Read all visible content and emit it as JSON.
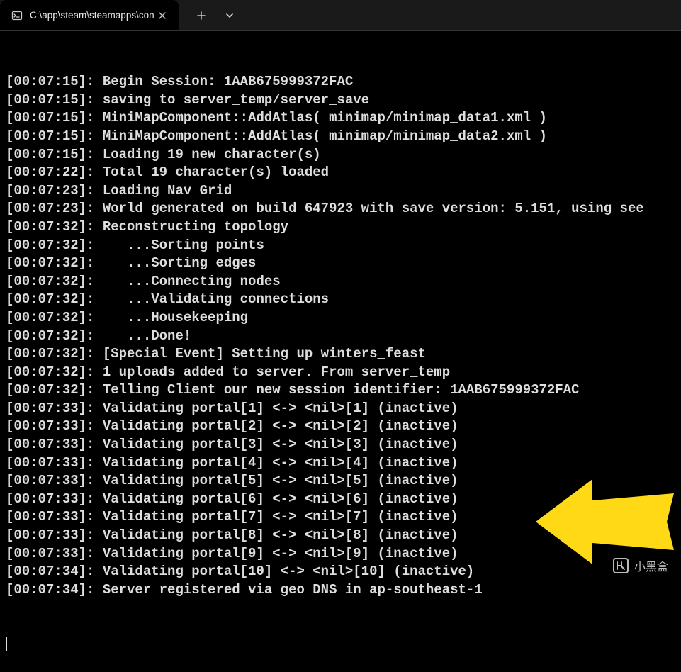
{
  "tab": {
    "title": "C:\\app\\steam\\steamapps\\con"
  },
  "log_lines": [
    "[00:07:15]: Begin Session: 1AAB675999372FAC",
    "[00:07:15]: saving to server_temp/server_save",
    "[00:07:15]: MiniMapComponent::AddAtlas( minimap/minimap_data1.xml )",
    "[00:07:15]: MiniMapComponent::AddAtlas( minimap/minimap_data2.xml )",
    "[00:07:15]: Loading 19 new character(s)",
    "[00:07:22]: Total 19 character(s) loaded",
    "[00:07:23]: Loading Nav Grid",
    "[00:07:23]: World generated on build 647923 with save version: 5.151, using see",
    "[00:07:32]: Reconstructing topology",
    "[00:07:32]:    ...Sorting points",
    "[00:07:32]:    ...Sorting edges",
    "[00:07:32]:    ...Connecting nodes",
    "[00:07:32]:    ...Validating connections",
    "[00:07:32]:    ...Housekeeping",
    "[00:07:32]:    ...Done!",
    "[00:07:32]: [Special Event] Setting up winters_feast",
    "[00:07:32]: 1 uploads added to server. From server_temp",
    "[00:07:32]: Telling Client our new session identifier: 1AAB675999372FAC",
    "[00:07:33]: Validating portal[1] <-> <nil>[1] (inactive)",
    "[00:07:33]: Validating portal[2] <-> <nil>[2] (inactive)",
    "[00:07:33]: Validating portal[3] <-> <nil>[3] (inactive)",
    "[00:07:33]: Validating portal[4] <-> <nil>[4] (inactive)",
    "[00:07:33]: Validating portal[5] <-> <nil>[5] (inactive)",
    "[00:07:33]: Validating portal[6] <-> <nil>[6] (inactive)",
    "[00:07:33]: Validating portal[7] <-> <nil>[7] (inactive)",
    "[00:07:33]: Validating portal[8] <-> <nil>[8] (inactive)",
    "[00:07:33]: Validating portal[9] <-> <nil>[9] (inactive)",
    "[00:07:34]: Validating portal[10] <-> <nil>[10] (inactive)",
    "[00:07:34]: Server registered via geo DNS in ap-southeast-1"
  ],
  "watermark_text": "小黑盒"
}
